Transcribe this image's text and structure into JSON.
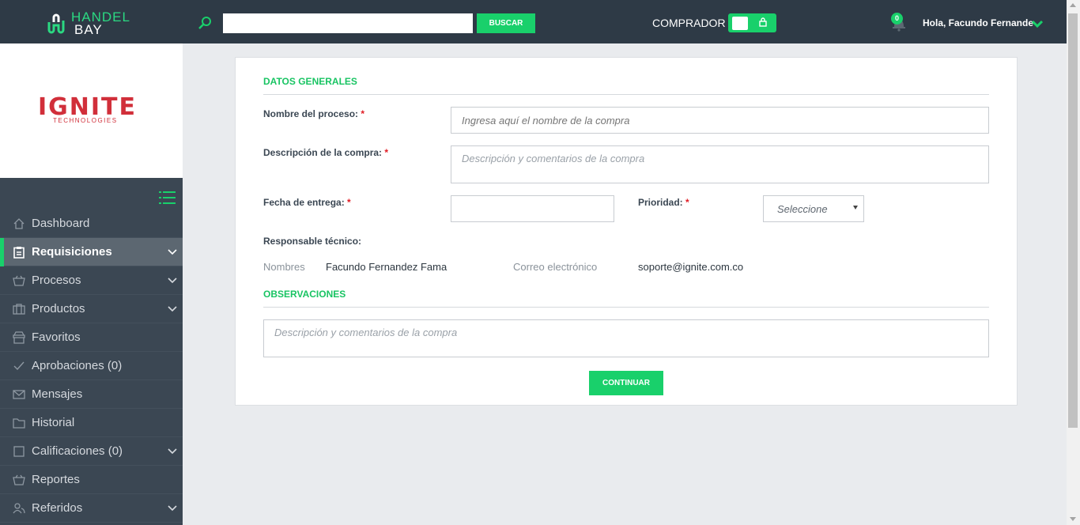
{
  "header": {
    "logo_line1": "HANDEL",
    "logo_line2": "BAY",
    "search_placeholder": "",
    "search_button": "BUSCAR",
    "mode_label": "COMPRADOR",
    "notifications_count": "0",
    "greeting": "Hola, Facundo Fernande",
    "accent_color": "#19d06b"
  },
  "company": {
    "name": "IGNITE",
    "tagline": "TECHNOLOGIES",
    "brand_color": "#d12f3a"
  },
  "sidebar": {
    "items": [
      {
        "label": "Dashboard",
        "icon": "home-icon",
        "has_chevron": false,
        "active": false
      },
      {
        "label": "Requisiciones",
        "icon": "clipboard-icon",
        "has_chevron": true,
        "active": true
      },
      {
        "label": "Procesos",
        "icon": "basket-icon",
        "has_chevron": true,
        "active": false
      },
      {
        "label": "Productos",
        "icon": "briefcase-icon",
        "has_chevron": true,
        "active": false
      },
      {
        "label": "Favoritos",
        "icon": "store-icon",
        "has_chevron": false,
        "active": false
      },
      {
        "label": "Aprobaciones (0)",
        "icon": "check-icon",
        "has_chevron": false,
        "active": false
      },
      {
        "label": "Mensajes",
        "icon": "envelope-icon",
        "has_chevron": false,
        "active": false
      },
      {
        "label": "Historial",
        "icon": "folder-icon",
        "has_chevron": false,
        "active": false
      },
      {
        "label": "Calificaciones (0)",
        "icon": "square-icon",
        "has_chevron": true,
        "active": false
      },
      {
        "label": "Reportes",
        "icon": "basket-icon",
        "has_chevron": false,
        "active": false
      },
      {
        "label": "Referidos",
        "icon": "users-icon",
        "has_chevron": true,
        "active": false
      }
    ]
  },
  "form": {
    "section_general": "DATOS GENERALES",
    "process_name_label": "Nombre del proceso:",
    "process_name_placeholder": "Ingresa aquí el nombre de la compra",
    "description_label": "Descripción de la compra:",
    "description_placeholder": "Descripción y comentarios de la compra",
    "delivery_date_label": "Fecha de entrega:",
    "delivery_date_value": "",
    "priority_label": "Prioridad:",
    "priority_selected": "Seleccione",
    "required_mark": "*",
    "tech_responsible_label": "Responsable técnico:",
    "names_label": "Nombres",
    "names_value": "Facundo Fernandez Fama",
    "email_label": "Correo electrónico",
    "email_value": "soporte@ignite.com.co",
    "section_observations": "OBSERVACIONES",
    "observations_placeholder": "Descripción y comentarios de la compra",
    "continue_button": "CONTINUAR"
  }
}
